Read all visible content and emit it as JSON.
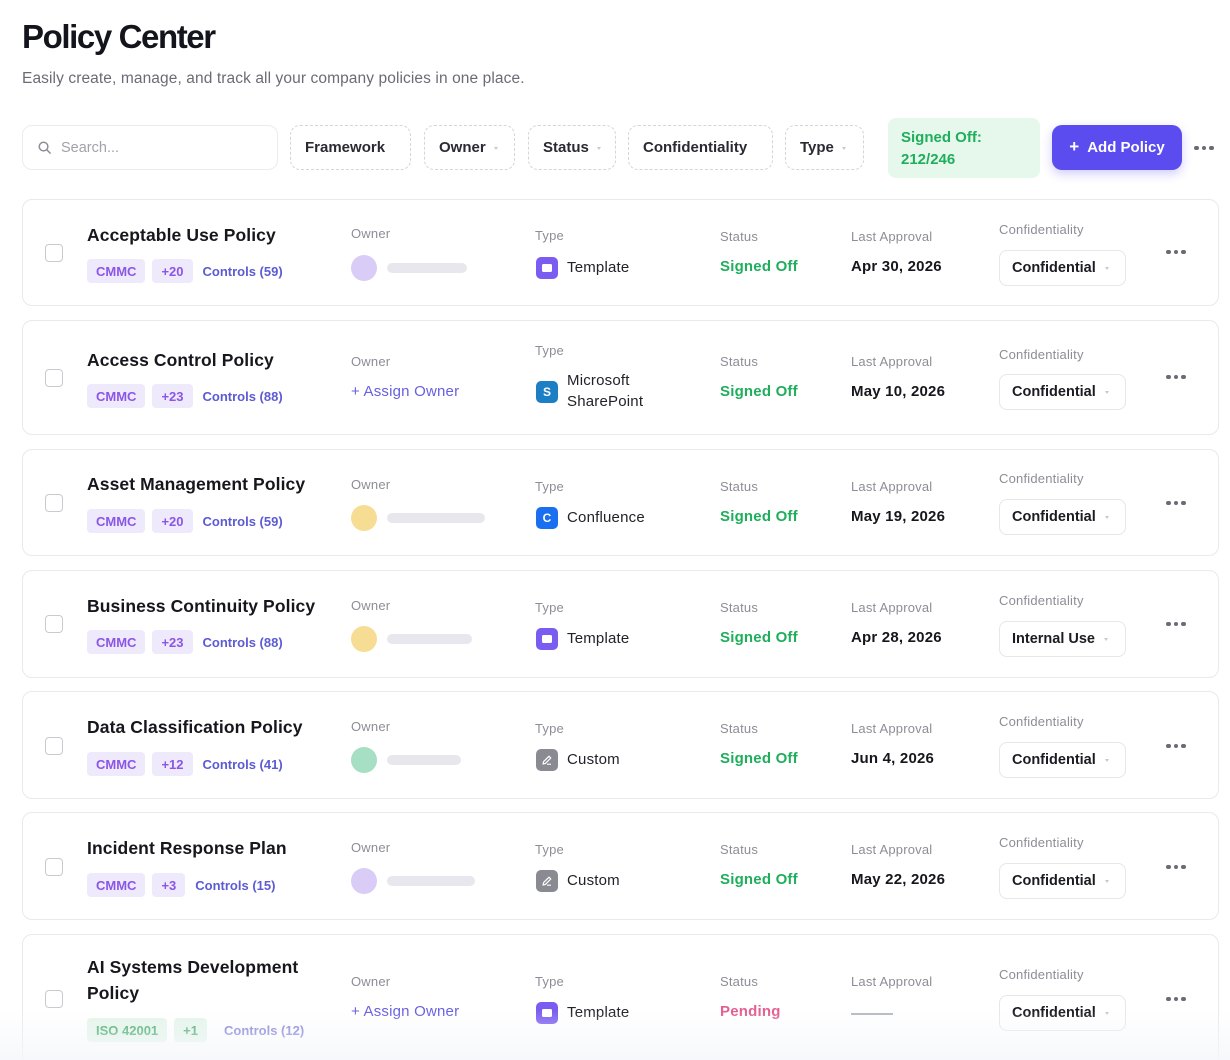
{
  "page": {
    "title": "Policy Center",
    "subtitle": "Easily create, manage, and track all your company policies in one place."
  },
  "toolbar": {
    "search_placeholder": "Search...",
    "filters": [
      "Framework",
      "Owner",
      "Status",
      "Confidentiality",
      "Type"
    ],
    "signed_off_label": "Signed Off:",
    "signed_off_value": "212/246",
    "add_button_label": "Add Policy",
    "add_button_icon": "plus-icon",
    "more_icon": "more-horizontal-icon"
  },
  "column_labels": {
    "owner": "Owner",
    "type": "Type",
    "status": "Status",
    "last_approval": "Last Approval",
    "confidentiality": "Confidentiality"
  },
  "colors": {
    "accent": "#5b4cf0",
    "signed_off": "#1fae5c",
    "pending": "#e45d8e",
    "signed_badge_bg": "#e6f8ec"
  },
  "policies": [
    {
      "name": "Acceptable Use Policy",
      "framework": "CMMC",
      "extra_frameworks": "+20",
      "controls": "Controls (59)",
      "owner": {
        "assigned": true,
        "avatar_color": "#d9cdf8"
      },
      "assign_label": "",
      "type": "Template",
      "type_icon": "template-icon",
      "status": "Signed Off",
      "last_approval": "Apr 30, 2026",
      "confidentiality": "Confidential"
    },
    {
      "name": "Access Control Policy",
      "framework": "CMMC",
      "extra_frameworks": "+23",
      "controls": "Controls (88)",
      "owner": {
        "assigned": false
      },
      "assign_label": "+ Assign Owner",
      "type": "Microsoft SharePoint",
      "type_icon": "sharepoint-icon",
      "status": "Signed Off",
      "last_approval": "May 10, 2026",
      "confidentiality": "Confidential"
    },
    {
      "name": "Asset Management Policy",
      "framework": "CMMC",
      "extra_frameworks": "+20",
      "controls": "Controls (59)",
      "owner": {
        "assigned": true,
        "avatar_color": "#f7dd93"
      },
      "assign_label": "",
      "type": "Confluence",
      "type_icon": "confluence-icon",
      "status": "Signed Off",
      "last_approval": "May 19, 2026",
      "confidentiality": "Confidential"
    },
    {
      "name": "Business Continuity Policy",
      "framework": "CMMC",
      "extra_frameworks": "+23",
      "controls": "Controls (88)",
      "owner": {
        "assigned": true,
        "avatar_color": "#f7dd93"
      },
      "assign_label": "",
      "type": "Template",
      "type_icon": "template-icon",
      "status": "Signed Off",
      "last_approval": "Apr 28, 2026",
      "confidentiality": "Internal Use"
    },
    {
      "name": "Data Classification Policy",
      "framework": "CMMC",
      "extra_frameworks": "+12",
      "controls": "Controls (41)",
      "owner": {
        "assigned": true,
        "avatar_color": "#a6dfc4"
      },
      "assign_label": "",
      "type": "Custom",
      "type_icon": "pencil-icon",
      "status": "Signed Off",
      "last_approval": "Jun 4, 2026",
      "confidentiality": "Confidential"
    },
    {
      "name": "Incident Response Plan",
      "framework": "CMMC",
      "extra_frameworks": "+3",
      "controls": "Controls (15)",
      "owner": {
        "assigned": true,
        "avatar_color": "#d9cdf8"
      },
      "assign_label": "",
      "type": "Custom",
      "type_icon": "pencil-icon",
      "status": "Signed Off",
      "last_approval": "May 22, 2026",
      "confidentiality": "Confidential"
    },
    {
      "name": "AI Systems Development Policy",
      "framework": "ISO 42001",
      "extra_frameworks": "+1",
      "controls": "Controls (12)",
      "owner": {
        "assigned": false
      },
      "assign_label": "+ Assign Owner",
      "type": "Template",
      "type_icon": "template-icon",
      "status": "Pending",
      "last_approval": "",
      "confidentiality": "Confidential"
    }
  ]
}
